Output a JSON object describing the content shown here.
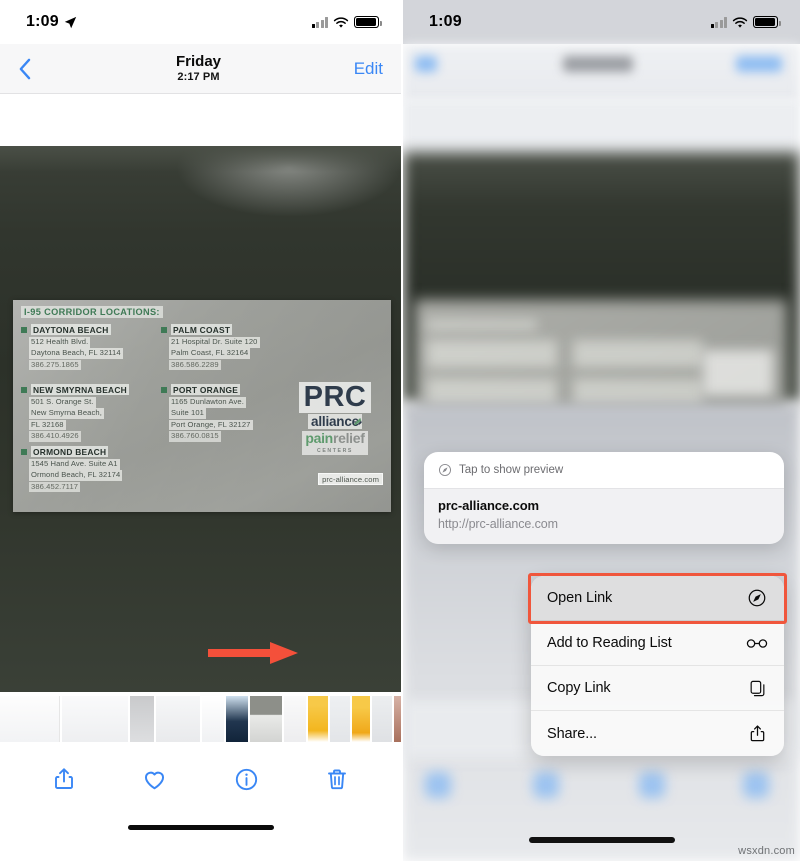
{
  "left_panel": {
    "status_bar": {
      "time": "1:09",
      "location_icon": "location-arrow-icon",
      "signal_icon": "cellular-signal-icon",
      "wifi_icon": "wifi-icon",
      "battery_icon": "battery-icon"
    },
    "nav_bar": {
      "back_icon": "chevron-left-icon",
      "title": "Friday",
      "subtitle": "2:17 PM",
      "edit_label": "Edit"
    },
    "photo": {
      "card_title": "I-95 CORRIDOR LOCATIONS:",
      "locations": [
        {
          "name": "DAYTONA BEACH",
          "lines": [
            "512 Health Blvd.",
            "Daytona Beach, FL 32114",
            "386.275.1865"
          ]
        },
        {
          "name": "PALM COAST",
          "lines": [
            "21 Hospital Dr. Suite 120",
            "Palm Coast, FL 32164",
            "386.586.2289"
          ]
        },
        {
          "name": "NEW SMYRNA BEACH",
          "lines": [
            "501 S. Orange St.",
            "New Smyrna Beach,",
            "FL 32168",
            "386.410.4926"
          ]
        },
        {
          "name": "PORT ORANGE",
          "lines": [
            "1165 Dunlawton Ave.",
            "Suite 101",
            "Port Orange, FL 32127",
            "386.760.0815"
          ]
        },
        {
          "name": "ORMOND BEACH",
          "lines": [
            "1545 Hand Ave. Suite A1",
            "Ormond Beach, FL 32174",
            "386.452.7117"
          ]
        }
      ],
      "logo": {
        "mark": "PRC",
        "alliance": "alliance",
        "pain": "pain",
        "relief": "relief",
        "centers": "CENTERS"
      },
      "url": "prc-alliance.com",
      "live_text_button": "live-text-scan-icon"
    },
    "toolbar": {
      "share": "share-icon",
      "favorite": "heart-icon",
      "info": "info-icon",
      "delete": "trash-icon"
    }
  },
  "right_panel": {
    "status_bar": {
      "time": "1:09",
      "signal_icon": "cellular-signal-icon",
      "wifi_icon": "wifi-icon",
      "battery_icon": "battery-icon"
    },
    "preview": {
      "hint": "Tap to show preview",
      "hint_icon": "safari-compass-icon",
      "title": "prc-alliance.com",
      "url": "http://prc-alliance.com"
    },
    "context_menu": {
      "items": [
        {
          "label": "Open Link",
          "icon": "safari-compass-icon",
          "selected": true
        },
        {
          "label": "Add to Reading List",
          "icon": "glasses-icon",
          "selected": false
        },
        {
          "label": "Copy Link",
          "icon": "copy-icon",
          "selected": false
        },
        {
          "label": "Share...",
          "icon": "share-icon",
          "selected": false
        }
      ]
    }
  },
  "colors": {
    "accent_blue": "#3a87f5",
    "highlight_red": "#f0563c",
    "live_text_blue": "#1b7ef3",
    "card_green": "#3f7a56",
    "logo_navy": "#2f3c4c"
  },
  "watermark": "wsxdn.com"
}
